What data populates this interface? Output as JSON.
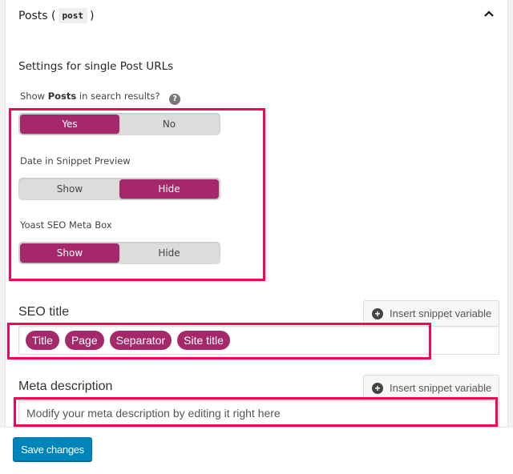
{
  "panel": {
    "title": "Posts (",
    "post_type_code": "post",
    "title_close": ")",
    "collapse_icon": "chevron-up-icon"
  },
  "settings": {
    "heading": "Settings for single Post URLs",
    "show_in_search": {
      "label_prefix": "Show ",
      "label_bold": "Posts",
      "label_suffix": " in search results?",
      "help_icon": "?",
      "options": [
        "Yes",
        "No"
      ],
      "selected": "Yes"
    },
    "date_in_snippet": {
      "label": "Date in Snippet Preview",
      "options": [
        "Show",
        "Hide"
      ],
      "selected": "Hide"
    },
    "meta_box": {
      "label": "Yoast SEO Meta Box",
      "options": [
        "Show",
        "Hide"
      ],
      "selected": "Show"
    }
  },
  "seo_title": {
    "label": "SEO title",
    "insert_button": "Insert snippet variable",
    "variables": [
      "Title",
      "Page",
      "Separator",
      "Site title"
    ]
  },
  "meta_description": {
    "label": "Meta description",
    "insert_button": "Insert snippet variable",
    "value": "Modify your meta description by editing it right here"
  },
  "footer": {
    "save_button": "Save changes"
  },
  "colors": {
    "accent": "#a4286a",
    "highlight": "#f5064f",
    "primary_button": "#0085ba"
  }
}
